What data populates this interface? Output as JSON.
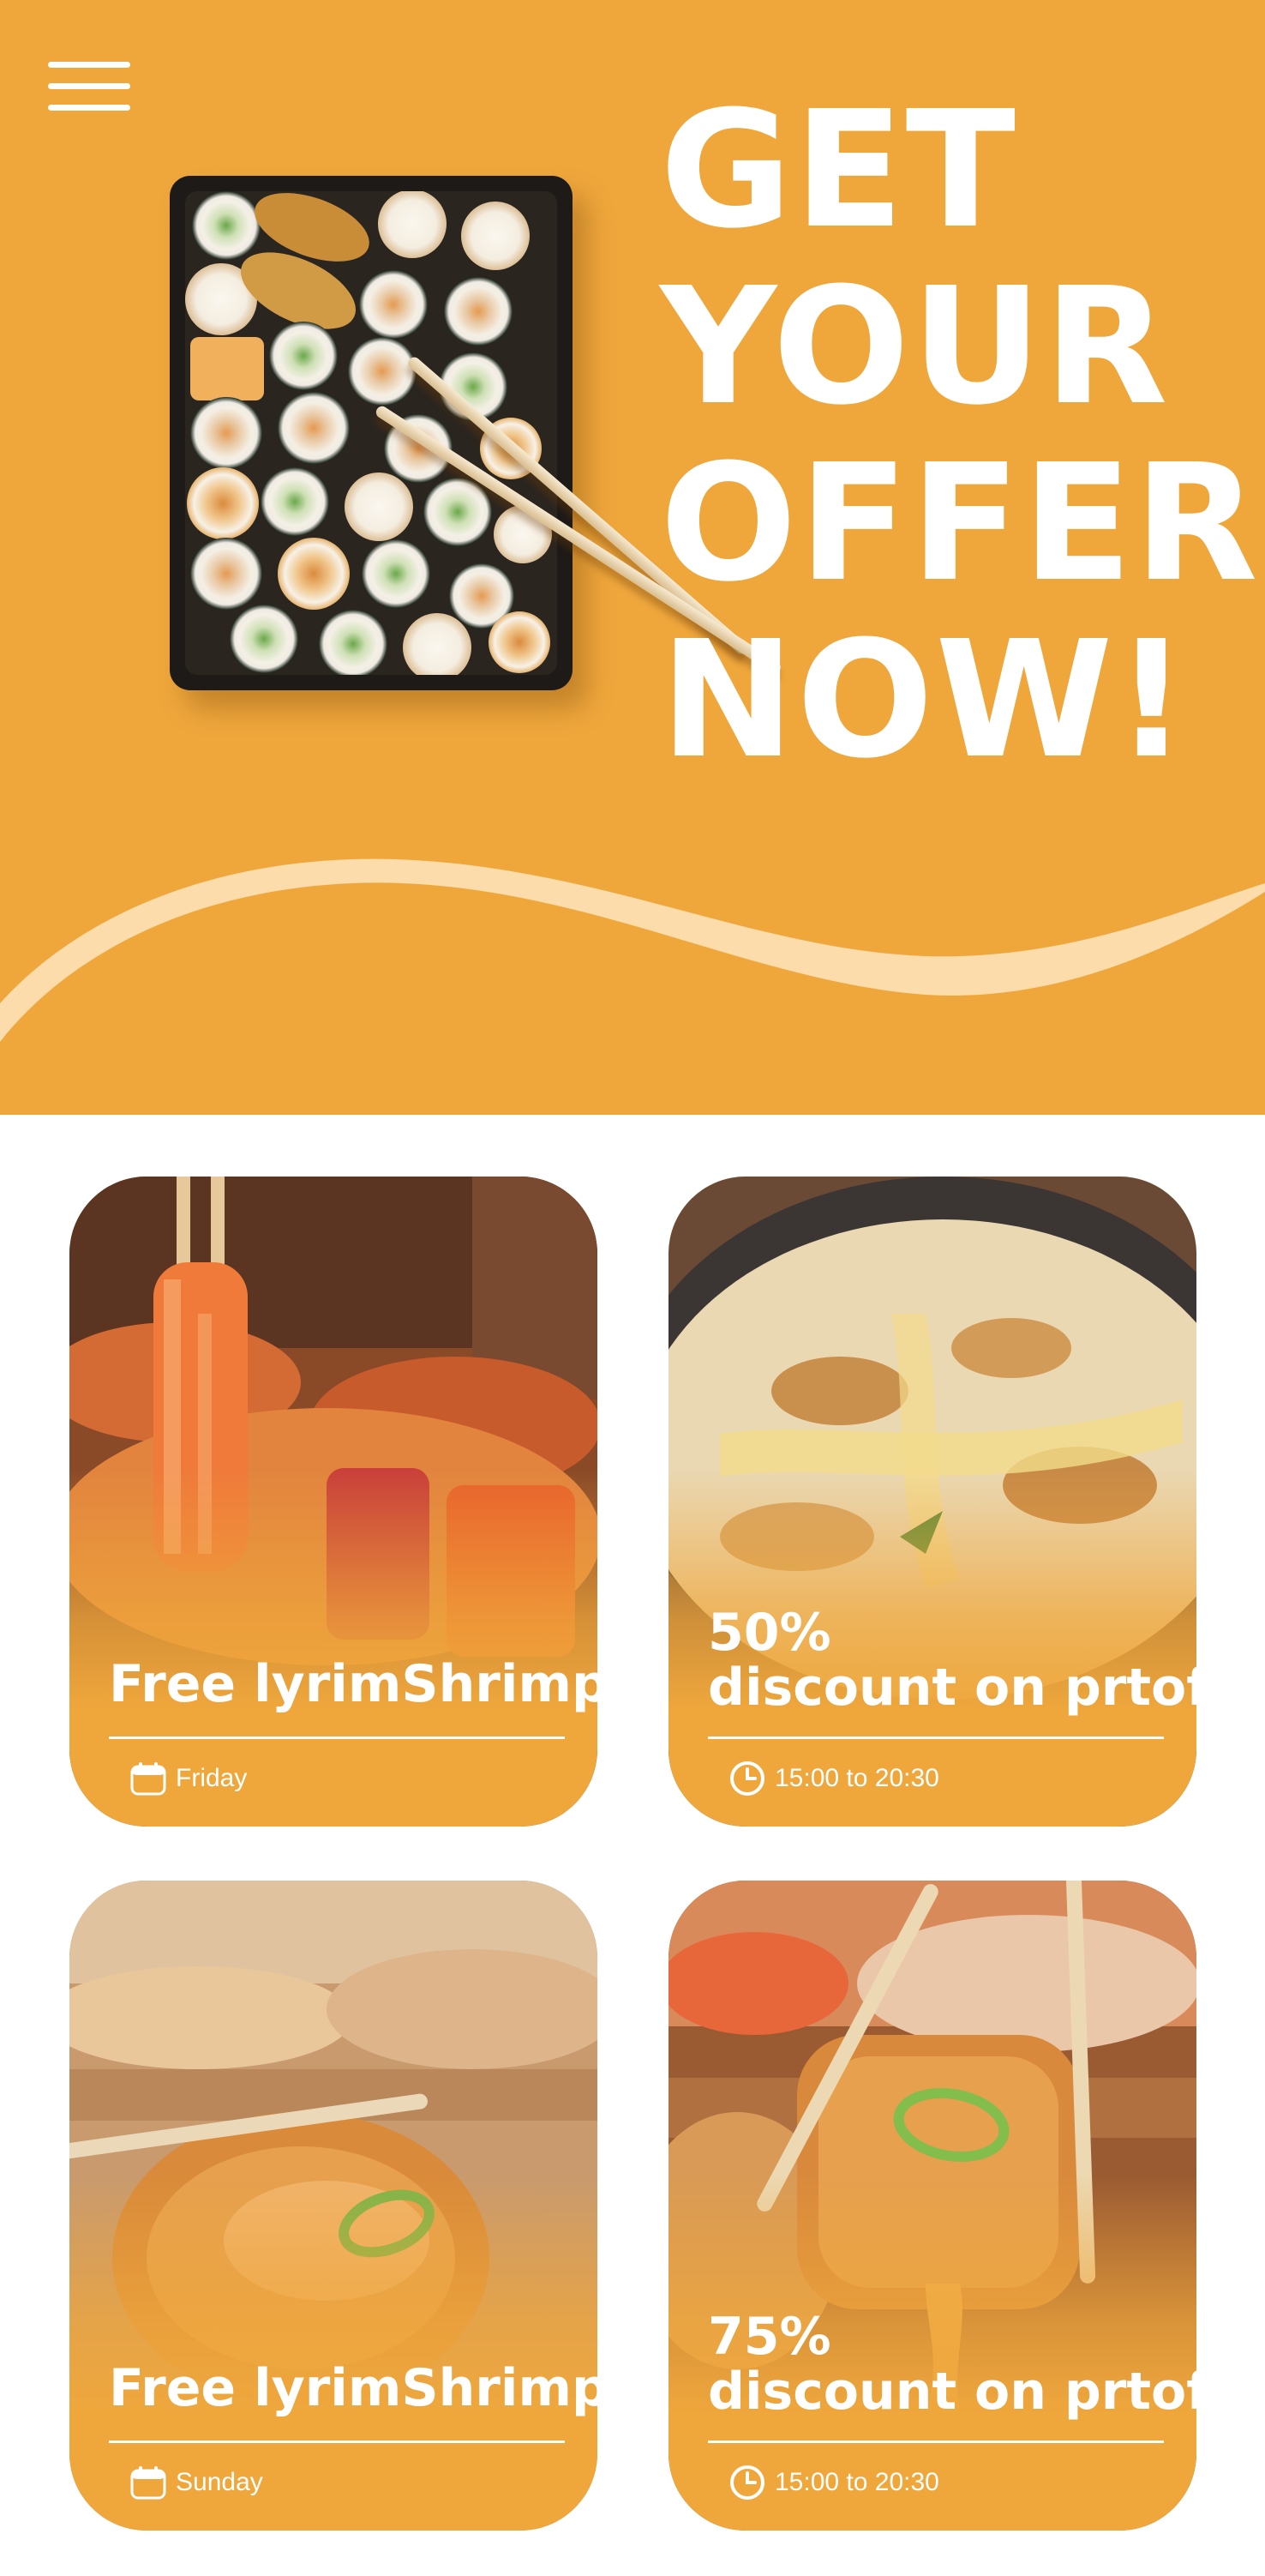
{
  "menu": {
    "icon": "hamburger-menu-icon"
  },
  "hero": {
    "headline_lines": [
      "GET",
      "YOUR",
      "OFFER",
      "NOW!"
    ],
    "background_color": "#efa73c",
    "wave_color": "#fbdcaa"
  },
  "offers": [
    {
      "title": "Free lyrimShrimp",
      "meta_icon": "calendar-icon",
      "meta": "Friday"
    },
    {
      "title_line1": "50%",
      "title_line2": "discount on prtof",
      "meta_icon": "clock-icon",
      "meta": "15:00 to 20:30"
    },
    {
      "title": "Free lyrimShrimp",
      "meta_icon": "calendar-icon",
      "meta": "Sunday"
    },
    {
      "title_line1": "75%",
      "title_line2": "discount on prtof",
      "meta_icon": "clock-icon",
      "meta": "15:00 to 20:30"
    }
  ]
}
